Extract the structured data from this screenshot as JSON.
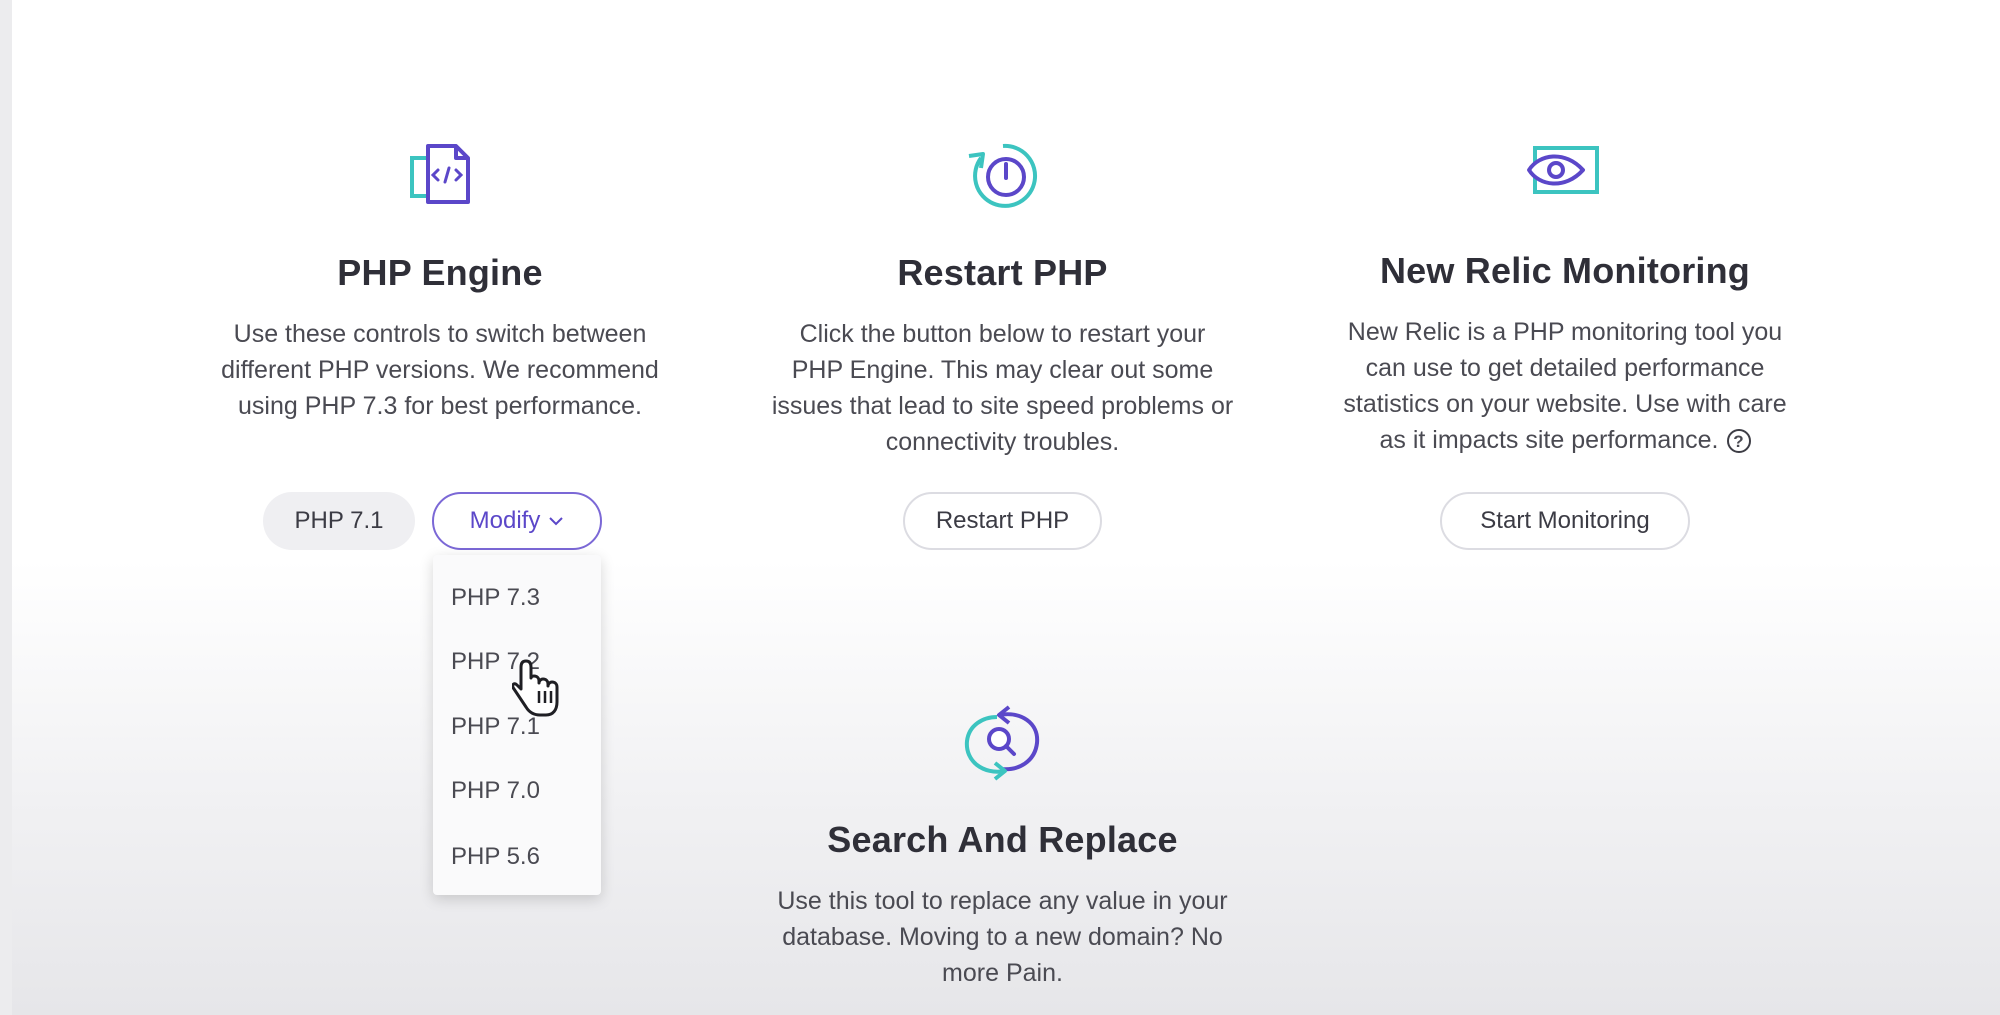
{
  "php_engine": {
    "title": "PHP Engine",
    "description_lines": [
      "Use these controls to switch between",
      "different PHP versions. We recommend",
      "using PHP 7.3 for best performance."
    ],
    "current_version": "PHP 7.1",
    "modify_label": "Modify",
    "dropdown_options": [
      "PHP 7.3",
      "PHP 7.2",
      "PHP 7.1",
      "PHP 7.0",
      "PHP 5.6"
    ],
    "icon": "php-code-file-icon"
  },
  "restart_php": {
    "title": "Restart PHP",
    "description_lines": [
      "Click the button below to restart your",
      "PHP Engine. This may clear out some",
      "issues that lead to site speed problems or",
      "connectivity troubles."
    ],
    "button_label": "Restart PHP",
    "icon": "restart-power-icon"
  },
  "new_relic": {
    "title": "New Relic Monitoring",
    "description_lines": [
      "New Relic is a PHP monitoring tool you",
      "can use to get detailed performance",
      "statistics on your website. Use with care",
      "as it impacts site performance."
    ],
    "help_symbol": "?",
    "button_label": "Start Monitoring",
    "icon": "monitor-eye-icon"
  },
  "search_replace": {
    "title": "Search And Replace",
    "description_lines": [
      "Use this tool to replace any value in your",
      "database. Moving to a new domain? No",
      "more Pain."
    ],
    "icon": "search-replace-icon"
  },
  "colors": {
    "accent_purple": "#5b47c9",
    "accent_teal": "#3cc4c0",
    "text_dark": "#2f2f38"
  }
}
